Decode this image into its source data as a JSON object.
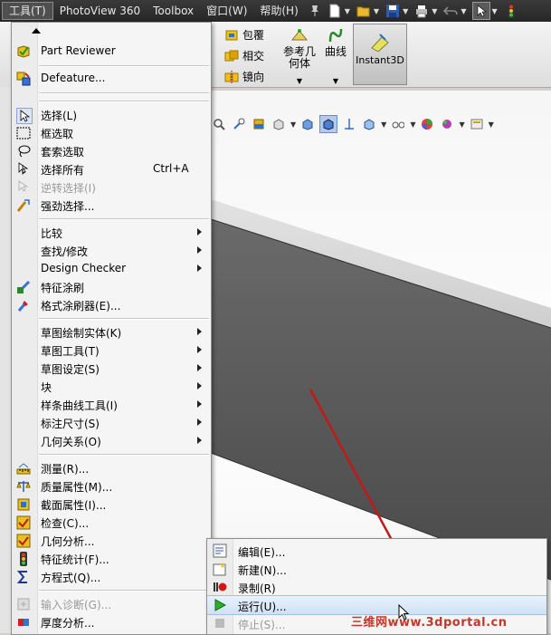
{
  "menubar": {
    "items": [
      "工具(T)",
      "PhotoView 360",
      "Toolbox",
      "窗口(W)",
      "帮助(H)"
    ]
  },
  "ribbon": {
    "wrap": "包覆",
    "intersect": "相交",
    "mirror": "镜向",
    "ref_geometry": "参考几何体",
    "curves": "曲线",
    "instant3d": "Instant3D"
  },
  "tools_menu": {
    "part_reviewer": "Part Reviewer",
    "defeature": "Defeature...",
    "select": "选择(L)",
    "box_select": "框选取",
    "lasso_select": "套索选取",
    "select_all": "选择所有",
    "select_all_shortcut": "Ctrl+A",
    "invert_select": "逆转选择(I)",
    "power_select": "强劲选择...",
    "compare": "比较",
    "find_modify": "查找/修改",
    "design_checker": "Design Checker",
    "feature_paint": "特征涂刷",
    "format_painter": "格式涂刷器(E)...",
    "sketch_entities": "草图绘制实体(K)",
    "sketch_tools": "草图工具(T)",
    "sketch_settings": "草图设定(S)",
    "blocks": "块",
    "spline_tools": "样条曲线工具(I)",
    "dimensions": "标注尺寸(S)",
    "relations": "几何关系(O)",
    "measure": "测量(R)...",
    "mass_properties": "质量属性(M)...",
    "section_properties": "截面属性(I)...",
    "check": "检查(C)...",
    "geometry_analysis": "几何分析...",
    "feature_statistics": "特征统计(F)...",
    "equations": "方程式(Q)...",
    "import_diagnostics": "输入诊断(G)...",
    "thickness_analysis": "厚度分析..."
  },
  "macro_menu": {
    "edit": "编辑(E)...",
    "new": "新建(N)...",
    "record": "录制(R)",
    "run": "运行(U)...",
    "stop": "停止(S)..."
  },
  "watermark": "三维网www.3dportal.cn"
}
